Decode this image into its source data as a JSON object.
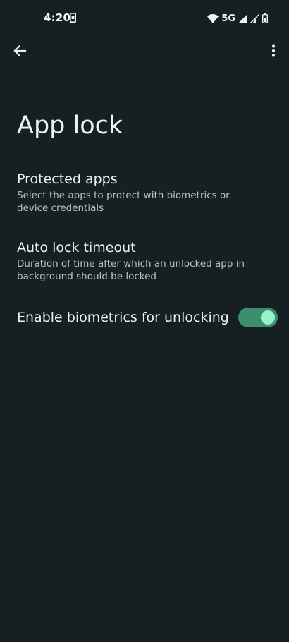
{
  "status_bar": {
    "time": "4:20",
    "network": "5G",
    "icons": [
      "sim-notification-icon",
      "wifi-icon",
      "signal-icon",
      "signal-icon-2",
      "battery-icon"
    ]
  },
  "top_bar": {
    "back_icon": "arrow-left-icon",
    "more_icon": "more-vert-icon"
  },
  "page": {
    "title": "App lock"
  },
  "preferences": {
    "protected_apps": {
      "title": "Protected apps",
      "summary": "Select the apps to protect with biometrics or device credentials"
    },
    "auto_lock_timeout": {
      "title": "Auto lock timeout",
      "summary": "Duration of time after which an unlocked app in background should be locked"
    },
    "biometrics": {
      "title": "Enable biometrics for unlocking",
      "enabled": true
    }
  },
  "colors": {
    "background": "#162022",
    "toggle_track": "#3b8f6e",
    "toggle_thumb": "#98f2c9"
  }
}
